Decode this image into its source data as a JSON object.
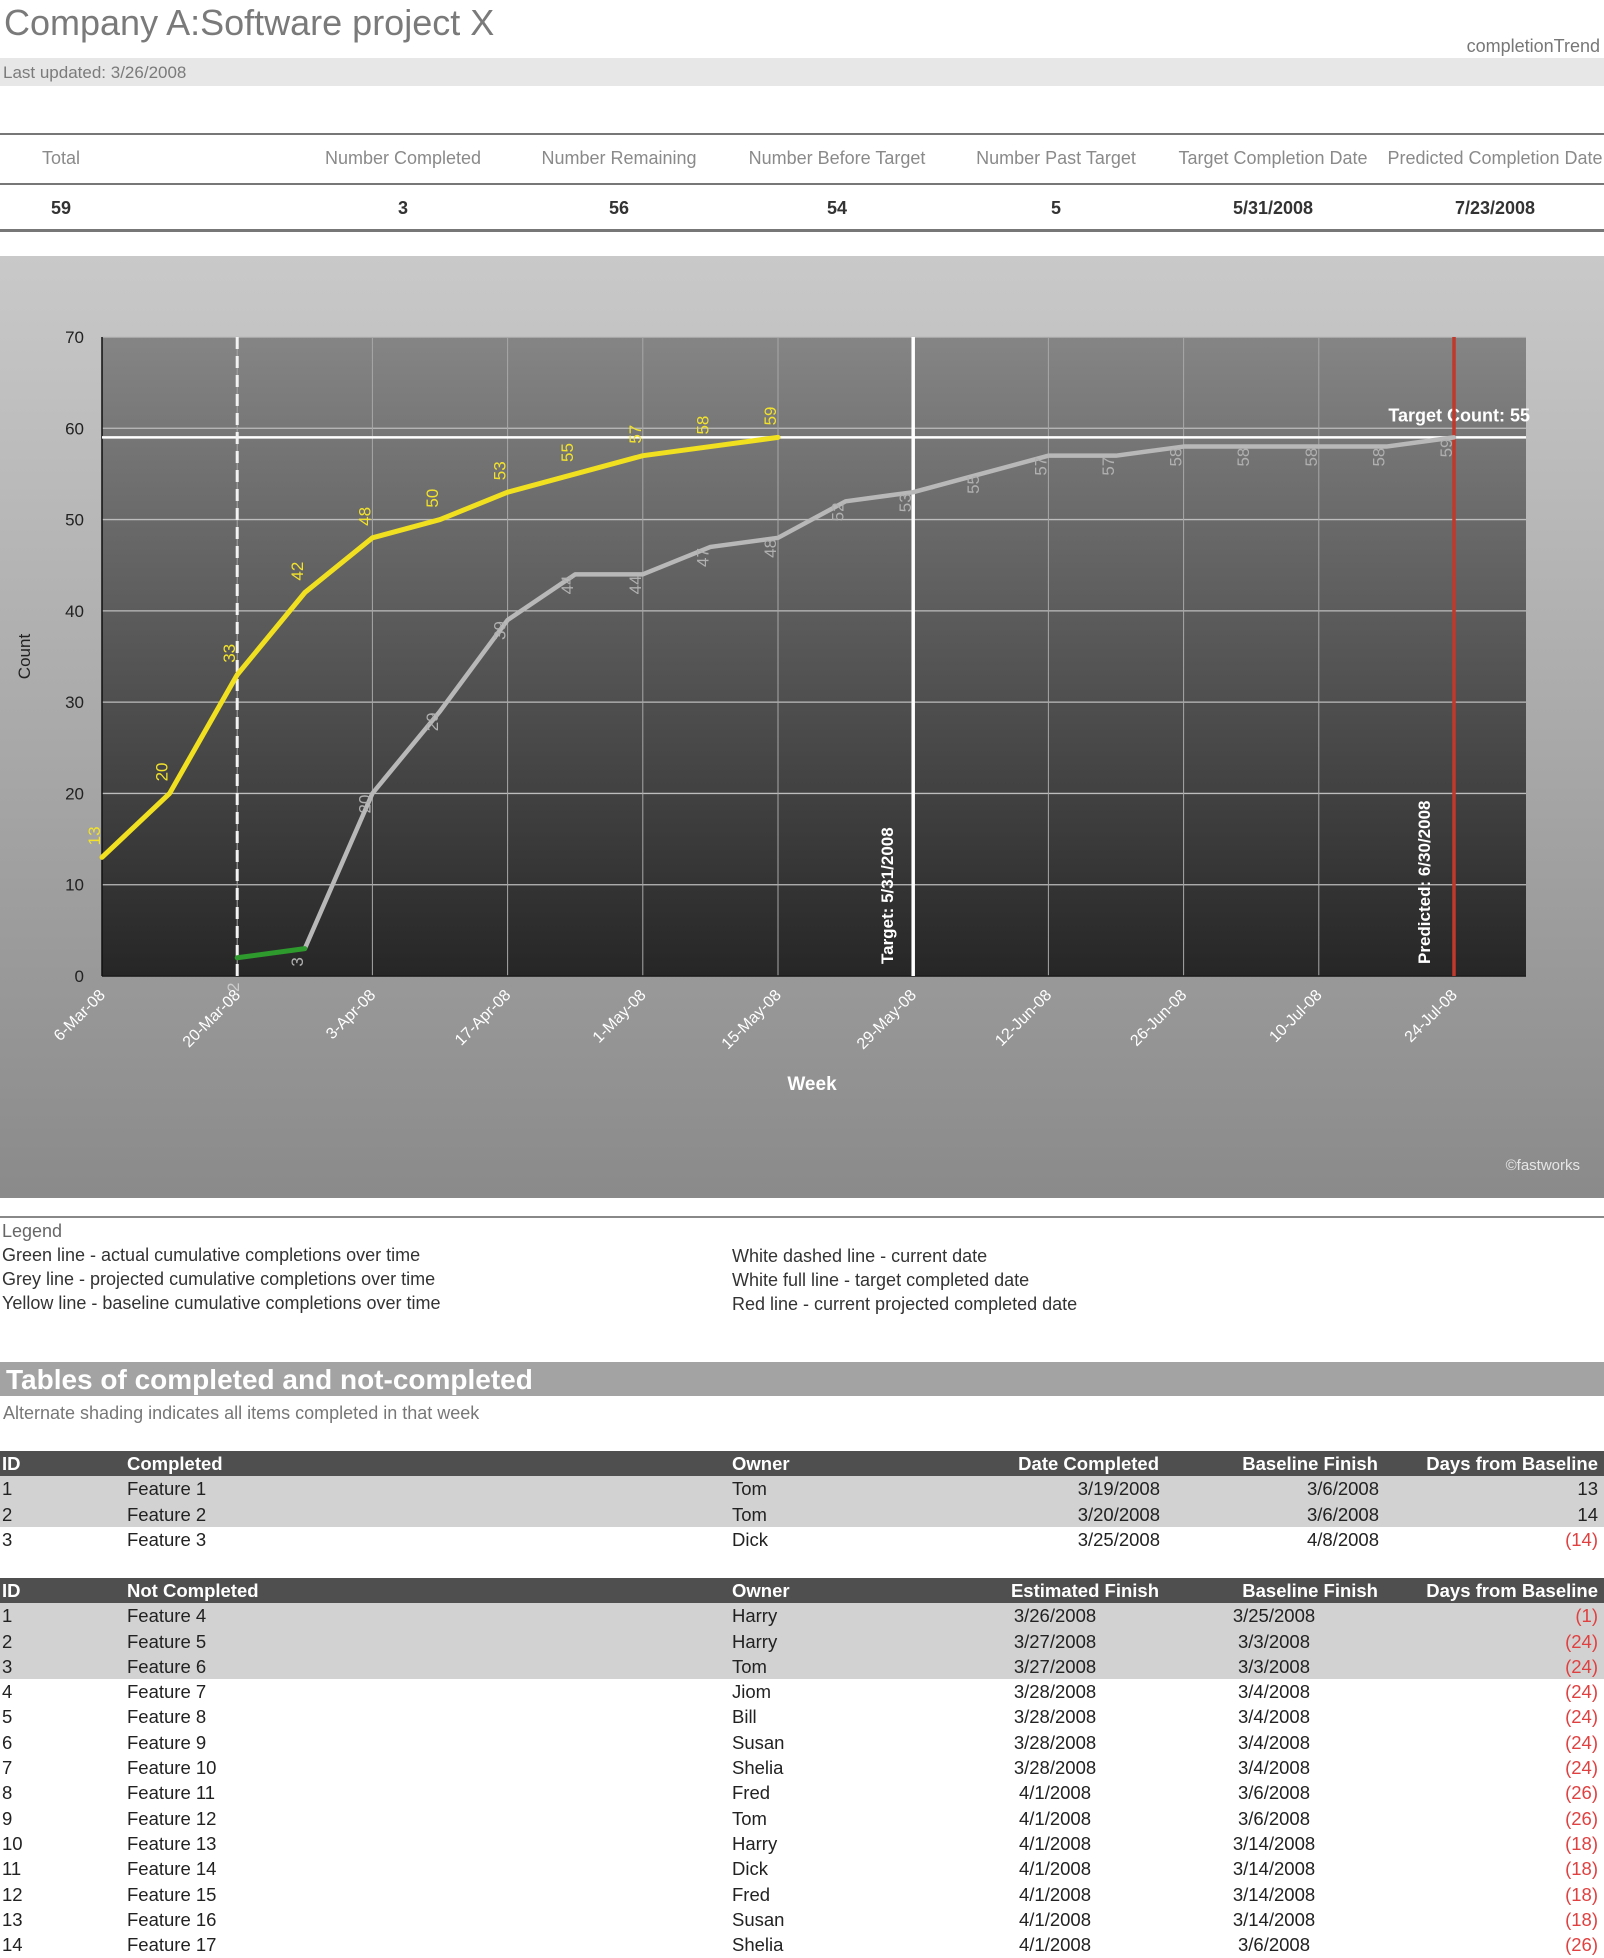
{
  "header": {
    "title": "Company A:Software project X",
    "report_name": "completionTrend",
    "last_updated": "Last updated:  3/26/2008"
  },
  "summary": {
    "headers": [
      "Total",
      "Number Completed",
      "Number Remaining",
      "Number Before Target",
      "Number Past Target",
      "Target Completion Date",
      "Predicted Completion Date"
    ],
    "values": [
      "59",
      "3",
      "56",
      "54",
      "5",
      "5/31/2008",
      "7/23/2008"
    ]
  },
  "chart_data": {
    "type": "line",
    "xlabel": "Week",
    "ylabel": "Count",
    "ylim": [
      0,
      70
    ],
    "yticks": [
      0,
      10,
      20,
      30,
      40,
      50,
      60,
      70
    ],
    "x_tick_labels": [
      "6-Mar-08",
      "20-Mar-08",
      "3-Apr-08",
      "17-Apr-08",
      "1-May-08",
      "15-May-08",
      "29-May-08",
      "12-Jun-08",
      "26-Jun-08",
      "10-Jul-08",
      "24-Jul-08"
    ],
    "x_start": "2008-03-06",
    "series": [
      {
        "color": "#f0e020",
        "x": [
          "2008-03-06",
          "2008-03-13",
          "2008-03-20",
          "2008-03-27",
          "2008-04-03",
          "2008-04-10",
          "2008-04-17",
          "2008-04-24",
          "2008-05-01",
          "2008-05-08",
          "2008-05-15"
        ],
        "values": [
          13,
          20,
          33,
          42,
          48,
          50,
          53,
          55,
          57,
          58,
          59
        ]
      },
      {
        "color": "#b8b8b8",
        "x": [
          "2008-03-27",
          "2008-04-03",
          "2008-04-10",
          "2008-04-17",
          "2008-04-24",
          "2008-05-01",
          "2008-05-08",
          "2008-05-15",
          "2008-05-22",
          "2008-05-29",
          "2008-06-05",
          "2008-06-12",
          "2008-06-19",
          "2008-06-26",
          "2008-07-03",
          "2008-07-10",
          "2008-07-17",
          "2008-07-24"
        ],
        "values": [
          3,
          20,
          29,
          39,
          44,
          44,
          47,
          48,
          52,
          53,
          55,
          57,
          57,
          58,
          58,
          58,
          58,
          59
        ]
      },
      {
        "color": "#2e9a2e",
        "x": [
          "2008-03-20",
          "2008-03-27"
        ],
        "values": [
          2,
          3
        ]
      }
    ],
    "target_count": 59,
    "target_count_label": "Target Count:  55",
    "target_date": "2008-05-29",
    "target_label": "Target: 5/31/2008",
    "predicted_date": "2008-07-24",
    "predicted_label": "Predicted: 6/30/2008",
    "current_date": "2008-03-20",
    "copyright": "©fastworks"
  },
  "legend": {
    "title": "Legend",
    "left": [
      "Green line - actual cumulative completions over time",
      "Grey line - projected cumulative completions over time",
      "Yellow line - baseline cumulative completions over time"
    ],
    "right": [
      "White dashed line - current date",
      "White full line - target completed date",
      "Red line - current projected completed date"
    ]
  },
  "section": {
    "title": "Tables of completed and not-completed",
    "note": "Alternate shading indicates all items completed in that week"
  },
  "completed_table": {
    "headers": [
      "ID",
      "Completed",
      "Owner",
      "Date Completed",
      "Baseline Finish",
      "Days from Baseline"
    ],
    "rows": [
      [
        "1",
        "Feature 1",
        "Tom",
        "3/19/2008",
        "3/6/2008",
        "13"
      ],
      [
        "2",
        "Feature 2",
        "Tom",
        "3/20/2008",
        "3/6/2008",
        "14"
      ],
      [
        "3",
        "Feature 3",
        "Dick",
        "3/25/2008",
        "4/8/2008",
        "(14)"
      ]
    ]
  },
  "not_completed_table": {
    "headers": [
      "ID",
      "Not Completed",
      "Owner",
      "Estimated Finish",
      "Baseline Finish",
      "Days from Baseline"
    ],
    "rows": [
      [
        "1",
        "Feature 4",
        "Harry",
        "3/26/2008",
        "3/25/2008",
        "(1)"
      ],
      [
        "2",
        "Feature 5",
        "Harry",
        "3/27/2008",
        "3/3/2008",
        "(24)"
      ],
      [
        "3",
        "Feature 6",
        "Tom",
        "3/27/2008",
        "3/3/2008",
        "(24)"
      ],
      [
        "4",
        "Feature 7",
        "Jiom",
        "3/28/2008",
        "3/4/2008",
        "(24)"
      ],
      [
        "5",
        "Feature 8",
        "Bill",
        "3/28/2008",
        "3/4/2008",
        "(24)"
      ],
      [
        "6",
        "Feature 9",
        "Susan",
        "3/28/2008",
        "3/4/2008",
        "(24)"
      ],
      [
        "7",
        "Feature 10",
        "Shelia",
        "3/28/2008",
        "3/4/2008",
        "(24)"
      ],
      [
        "8",
        "Feature 11",
        "Fred",
        "4/1/2008",
        "3/6/2008",
        "(26)"
      ],
      [
        "9",
        "Feature 12",
        "Tom",
        "4/1/2008",
        "3/6/2008",
        "(26)"
      ],
      [
        "10",
        "Feature 13",
        "Harry",
        "4/1/2008",
        "3/14/2008",
        "(18)"
      ],
      [
        "11",
        "Feature 14",
        "Dick",
        "4/1/2008",
        "3/14/2008",
        "(18)"
      ],
      [
        "12",
        "Feature 15",
        "Fred",
        "4/1/2008",
        "3/14/2008",
        "(18)"
      ],
      [
        "13",
        "Feature 16",
        "Susan",
        "4/1/2008",
        "3/14/2008",
        "(18)"
      ],
      [
        "14",
        "Feature 17",
        "Shelia",
        "4/1/2008",
        "3/6/2008",
        "(26)"
      ]
    ]
  }
}
